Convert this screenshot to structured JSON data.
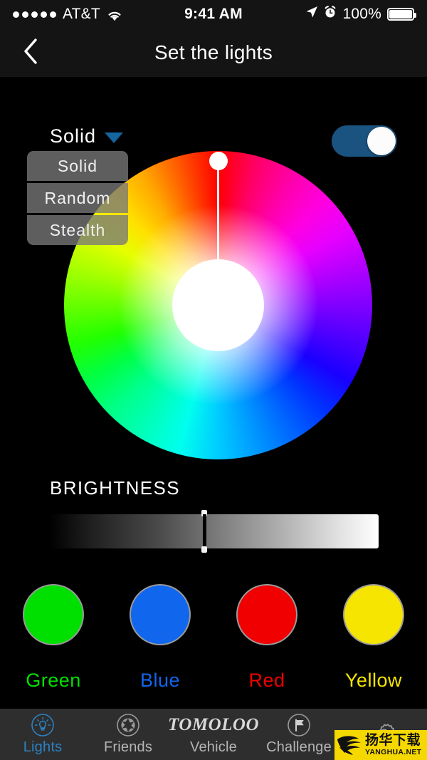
{
  "status_bar": {
    "signal_dots": 5,
    "carrier": "AT&T",
    "wifi_icon": "wifi-icon",
    "time": "9:41 AM",
    "location_icon": "location-arrow-icon",
    "alarm_icon": "alarm-clock-icon",
    "battery_percent": "100%",
    "battery_icon": "battery-full-icon"
  },
  "nav": {
    "back_icon": "chevron-left-icon",
    "title": "Set the lights"
  },
  "mode": {
    "selected": "Solid",
    "caret_icon": "caret-down-icon",
    "caret_color": "#1565a0",
    "options": [
      "Solid",
      "Random",
      "Stealth"
    ]
  },
  "power_toggle": {
    "state": "on",
    "track_color": "#1a5380",
    "knob_color": "#fcfcfc"
  },
  "color_wheel": {
    "label": "color-wheel",
    "handle_position": "top",
    "handle_hue_degrees": 0,
    "selected_color": "#ffffff"
  },
  "brightness": {
    "label": "BRIGHTNESS",
    "value_percent": 47,
    "gradient_from": "#000000",
    "gradient_to": "#ffffff"
  },
  "presets": [
    {
      "name": "Green",
      "color": "#00e000",
      "label_color": "#00e000"
    },
    {
      "name": "Blue",
      "color": "#1166ee",
      "label_color": "#1166ee"
    },
    {
      "name": "Red",
      "color": "#f00000",
      "label_color": "#f00000"
    },
    {
      "name": "Yellow",
      "color": "#f5e500",
      "label_color": "#f5e500"
    }
  ],
  "tabs": [
    {
      "label": "Lights",
      "icon": "lightbulb-icon",
      "active": true
    },
    {
      "label": "Friends",
      "icon": "aperture-icon",
      "active": false
    },
    {
      "label": "Vehicle",
      "icon": "tomoloo-logo",
      "logo_text": "TOMOLOO",
      "active": false
    },
    {
      "label": "Challenge",
      "icon": "flag-icon",
      "active": false
    },
    {
      "label": "",
      "icon": "gear-icon",
      "active": false
    }
  ],
  "active_tab_color": "#2b82c4",
  "watermark": {
    "cn_text": "扬华下载",
    "en_text": "YANGHUA.NET",
    "background": "#f5d800",
    "icon": "eagle-logo-icon"
  }
}
